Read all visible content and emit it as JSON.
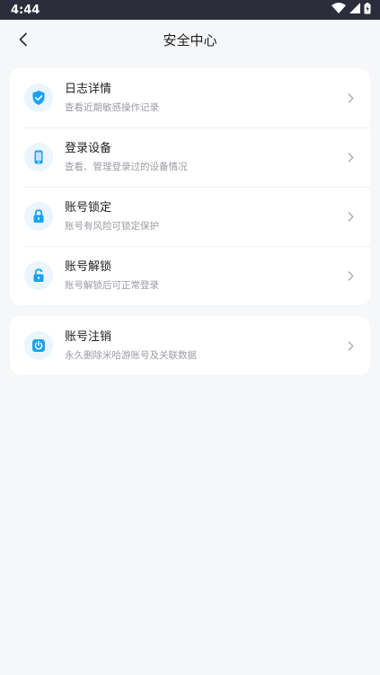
{
  "status_bar": {
    "time": "4:44",
    "icons": [
      "wifi-icon",
      "signal-icon",
      "battery-icon"
    ]
  },
  "header": {
    "title": "安全中心",
    "back_icon": "chevron-left-icon"
  },
  "sections": [
    {
      "items": [
        {
          "icon": "shield-check-icon",
          "title": "日志详情",
          "subtitle": "查看近期敏感操作记录"
        },
        {
          "icon": "phone-device-icon",
          "title": "登录设备",
          "subtitle": "查看、管理登录过的设备情况"
        },
        {
          "icon": "lock-icon",
          "title": "账号锁定",
          "subtitle": "账号有风险可锁定保护"
        },
        {
          "icon": "unlock-icon",
          "title": "账号解锁",
          "subtitle": "账号解锁后可正常登录"
        }
      ]
    },
    {
      "items": [
        {
          "icon": "power-icon",
          "title": "账号注销",
          "subtitle": "永久删除米哈游账号及关联数据"
        }
      ]
    }
  ],
  "colors": {
    "accent": "#1aa3f0",
    "icon_bg": "#eaf5fd",
    "status_bar": "#2b2d3a",
    "background": "#f6f7f9"
  }
}
